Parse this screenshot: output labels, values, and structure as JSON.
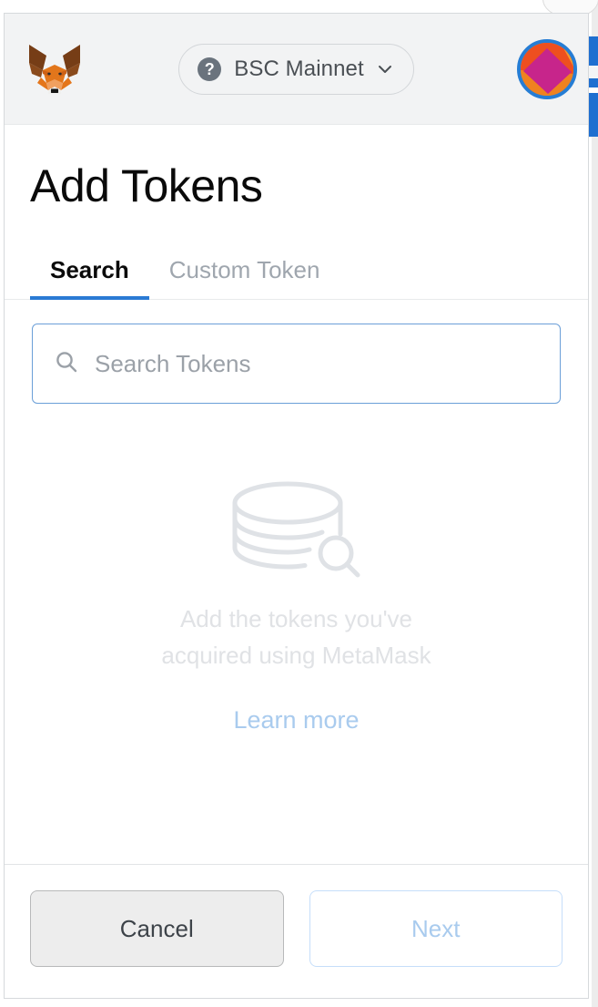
{
  "window": {
    "app_name": "MetaMask",
    "logo_icon": "metamask-fox-logo"
  },
  "header": {
    "network": {
      "icon": "question-mark-icon",
      "icon_glyph": "?",
      "label": "BSC Mainnet",
      "chevron_icon": "chevron-down-icon"
    },
    "account": {
      "avatar_icon": "account-jazzicon-avatar"
    }
  },
  "main": {
    "title": "Add Tokens",
    "tabs": [
      {
        "label": "Search",
        "active": true
      },
      {
        "label": "Custom Token",
        "active": false
      }
    ],
    "search": {
      "icon": "search-icon",
      "value": "",
      "placeholder": "Search Tokens"
    },
    "empty_state": {
      "illustration_icon": "token-stack-search-illustration",
      "message": "Add the tokens you've acquired using MetaMask",
      "message_line_1": "Add the tokens you've",
      "message_line_2": "acquired using MetaMask",
      "link_label": "Learn more"
    }
  },
  "footer": {
    "cancel_label": "Cancel",
    "next_label": "Next"
  },
  "colors": {
    "accent_blue": "#2a7ad4",
    "header_bg": "#f2f3f4",
    "tab_active_text": "#0a0a0a",
    "tab_inactive_text": "#9fa6ae",
    "input_border_focus": "#6b9fd8",
    "empty_text": "#e0e2e5",
    "link_blue": "#a9cbee",
    "cancel_bg": "#ededed",
    "avatar_ring": "#267dd4"
  }
}
